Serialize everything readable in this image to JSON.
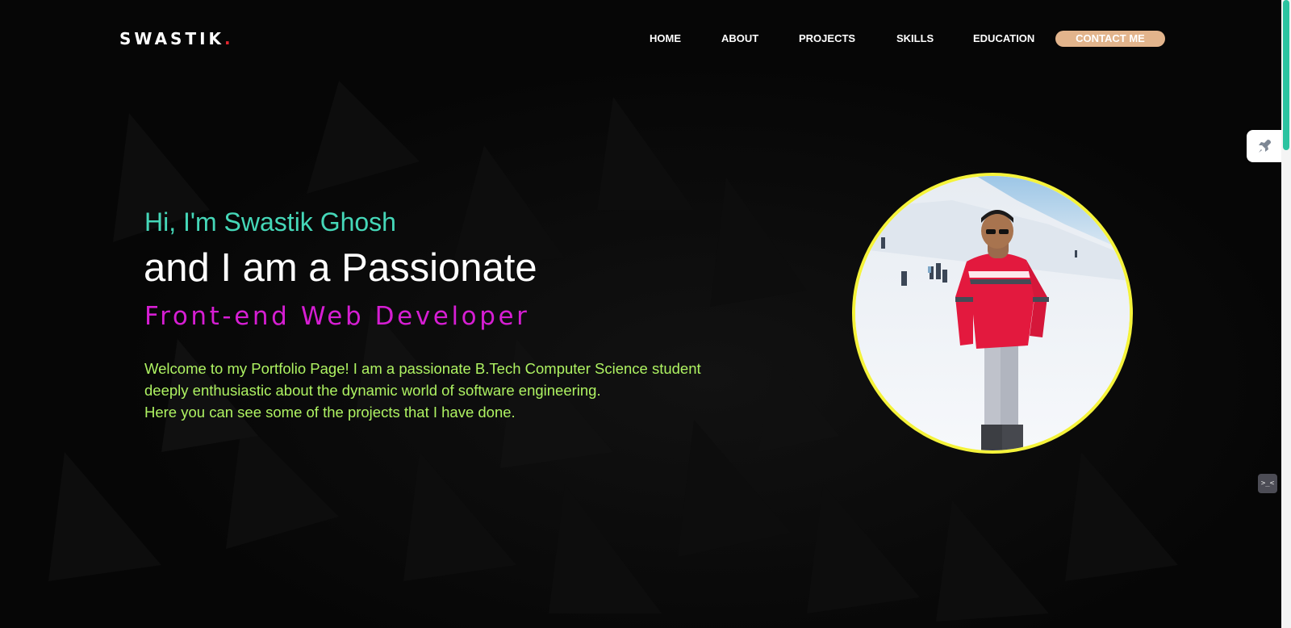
{
  "header": {
    "logo_text": "SWASTIK",
    "logo_dot": ".",
    "nav": [
      {
        "label": "HOME"
      },
      {
        "label": "ABOUT"
      },
      {
        "label": "PROJECTS"
      },
      {
        "label": "SKILLS"
      },
      {
        "label": "EDUCATION"
      }
    ],
    "contact_label": "CONTACT ME"
  },
  "hero": {
    "greeting": "Hi, I'm Swastik Ghosh",
    "tagline": "and I am a Passionate",
    "role": "Front-end Web Developer",
    "intro_lines": [
      "Welcome to my Portfolio Page! I am a passionate B.Tech Computer Science student",
      "deeply enthusiastic about the dynamic world of software engineering.",
      "Here you can see some of the projects that I have done."
    ]
  },
  "widgets": {
    "rocket_icon": "rocket-icon",
    "terminal_icon": "terminal-icon",
    "terminal_glyph": ">_<"
  },
  "colors": {
    "background": "#060606",
    "greeting": "#45d7b8",
    "role": "#d61ed3",
    "intro": "#aef262",
    "accent_button": "#e2b48c",
    "avatar_border": "#f5f33a",
    "logo_dot": "#e3262f"
  }
}
